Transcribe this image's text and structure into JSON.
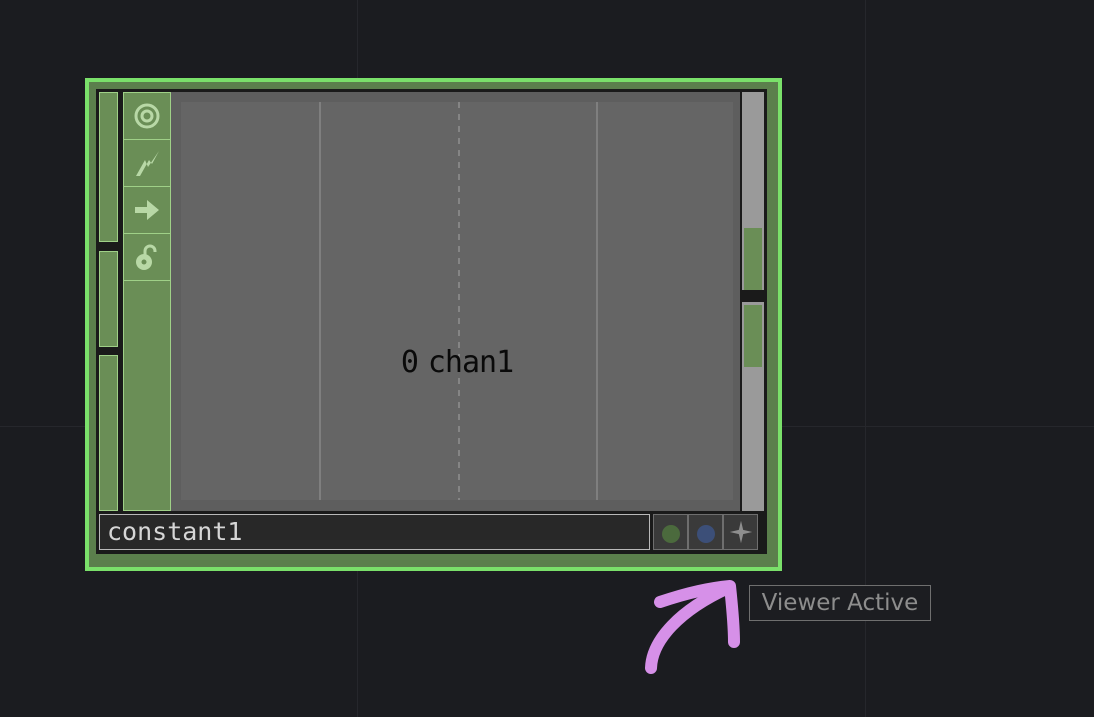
{
  "node": {
    "name": "constant1",
    "viewer_label": {
      "value": "0",
      "channel": "chan1"
    },
    "icons": [
      "viewer-toggle-icon",
      "bypass-icon",
      "export-arrow-icon",
      "lock-icon"
    ],
    "flags": [
      {
        "name": "display-flag",
        "color": "#4b6a3d"
      },
      {
        "name": "render-flag",
        "color": "#3c4f78"
      },
      {
        "name": "star-flag",
        "color": "#8e8e8e"
      }
    ],
    "border_color": "#7ae06a"
  },
  "tooltip": {
    "text": "Viewer Active"
  },
  "annotation": {
    "arrow_color": "#d690e8"
  }
}
